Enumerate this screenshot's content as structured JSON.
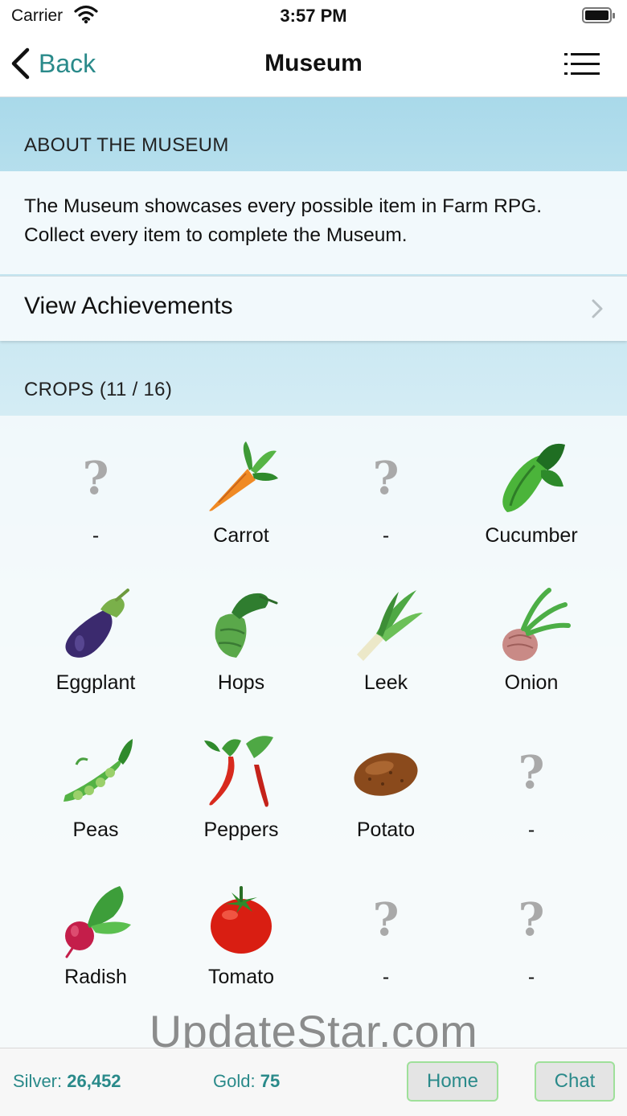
{
  "status_bar": {
    "carrier": "Carrier",
    "time": "3:57 PM"
  },
  "nav": {
    "back_label": "Back",
    "title": "Museum",
    "menu_icon": "list-icon"
  },
  "about": {
    "header": "ABOUT THE MUSEUM",
    "text": "The Museum showcases every possible item in Farm RPG. Collect every item to complete the Museum."
  },
  "achievements": {
    "label": "View Achievements"
  },
  "crops": {
    "header": "CROPS (11 / 16)",
    "items": [
      {
        "name": "-",
        "icon": "unknown-icon"
      },
      {
        "name": "Carrot",
        "icon": "carrot-icon"
      },
      {
        "name": "-",
        "icon": "unknown-icon"
      },
      {
        "name": "Cucumber",
        "icon": "cucumber-icon"
      },
      {
        "name": "Eggplant",
        "icon": "eggplant-icon"
      },
      {
        "name": "Hops",
        "icon": "hops-icon"
      },
      {
        "name": "Leek",
        "icon": "leek-icon"
      },
      {
        "name": "Onion",
        "icon": "onion-icon"
      },
      {
        "name": "Peas",
        "icon": "peas-icon"
      },
      {
        "name": "Peppers",
        "icon": "peppers-icon"
      },
      {
        "name": "Potato",
        "icon": "potato-icon"
      },
      {
        "name": "-",
        "icon": "unknown-icon"
      },
      {
        "name": "Radish",
        "icon": "radish-icon"
      },
      {
        "name": "Tomato",
        "icon": "tomato-icon"
      },
      {
        "name": "-",
        "icon": "unknown-icon"
      },
      {
        "name": "-",
        "icon": "unknown-icon"
      }
    ]
  },
  "unknown_glyph": "?",
  "watermark": "UpdateStar.com",
  "toolbar": {
    "silver_label": "Silver:",
    "silver_value": "26,452",
    "gold_label": "Gold:",
    "gold_value": "75",
    "home_label": "Home",
    "chat_label": "Chat"
  },
  "colors": {
    "accent": "#2a8a8a",
    "button_border": "#9fe09a",
    "header_blue": "#a9d9ea"
  }
}
